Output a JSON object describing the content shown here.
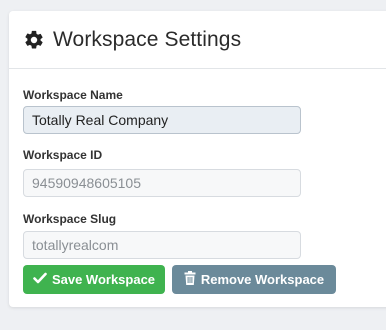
{
  "header": {
    "title": "Workspace Settings",
    "icon": "gear-icon"
  },
  "form": {
    "name": {
      "label": "Workspace Name",
      "value": "Totally Real Company"
    },
    "id": {
      "label": "Workspace ID",
      "value": "94590948605105"
    },
    "slug": {
      "label": "Workspace Slug",
      "value": "totallyrealcom"
    }
  },
  "actions": {
    "save_label": "Save Workspace",
    "remove_label": "Remove Workspace",
    "save_color": "#3fb34f",
    "remove_color": "#6b8a9a"
  }
}
